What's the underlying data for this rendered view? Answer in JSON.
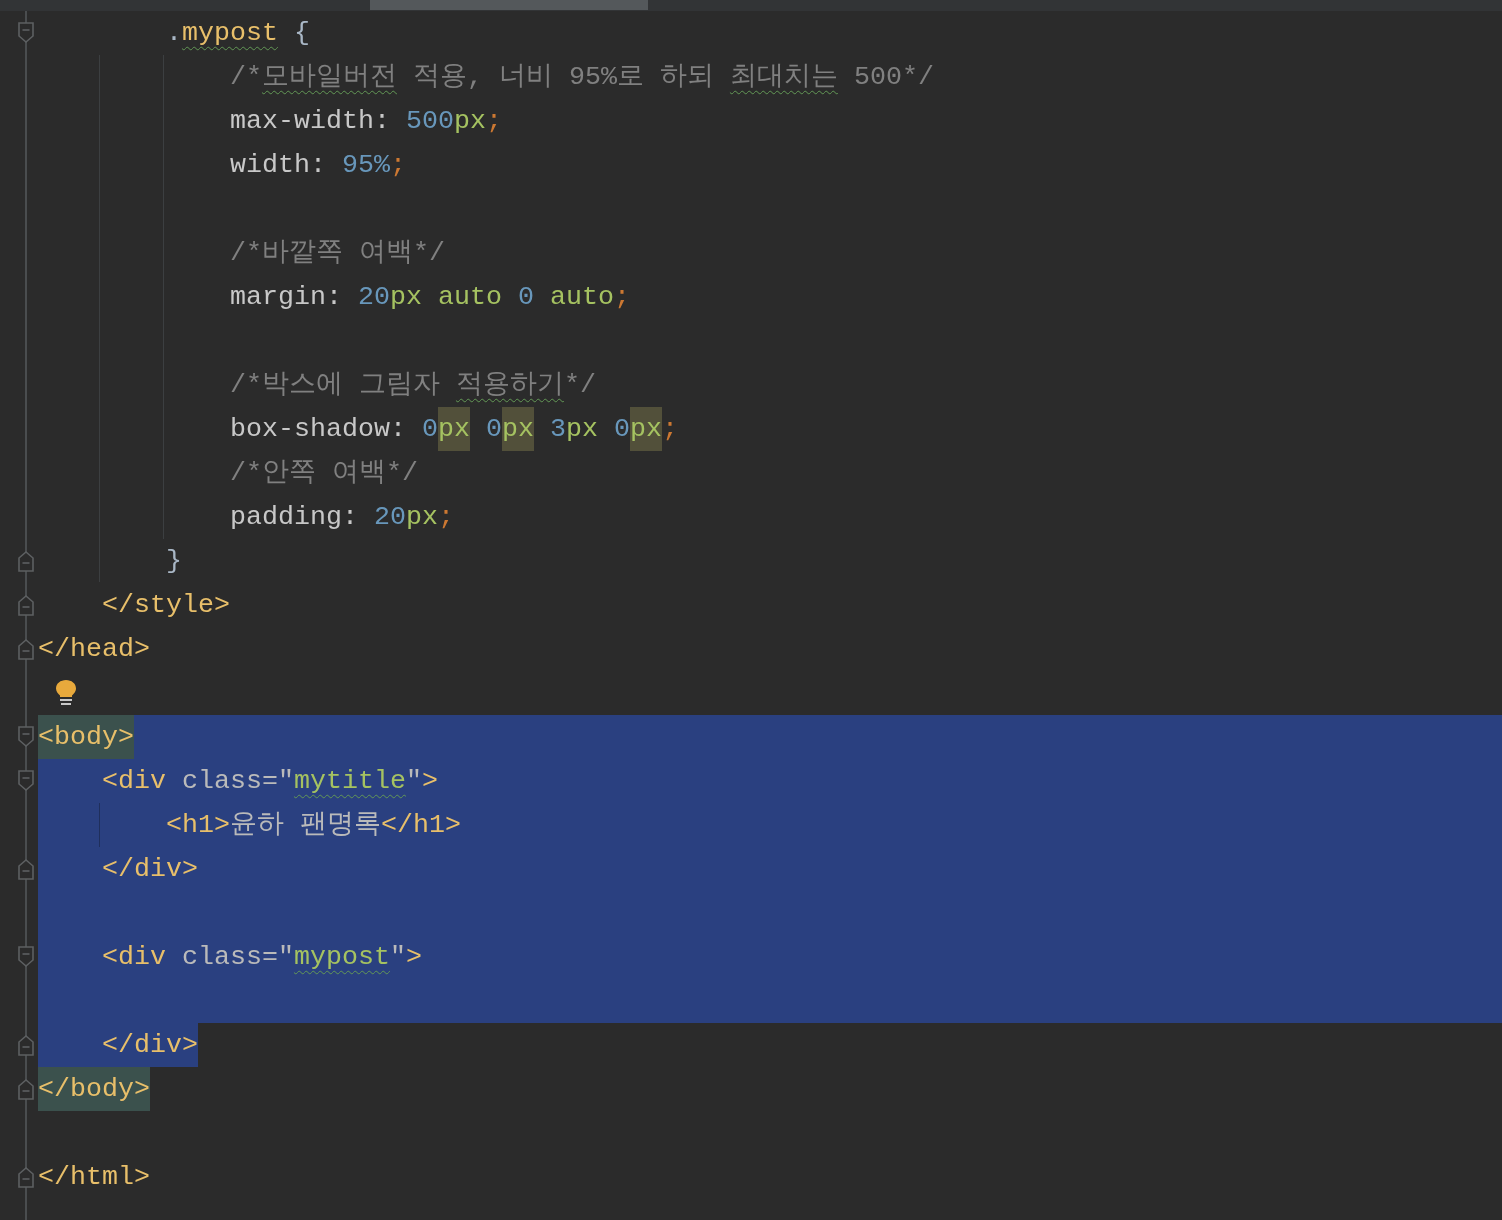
{
  "editor": {
    "lines": [
      {
        "kind": "fold-start",
        "selected": false,
        "tokens": [
          {
            "kind": "plain",
            "text": "        ."
          },
          {
            "kind": "selector",
            "text": "mypost",
            "squiggle": true
          },
          {
            "kind": "plain",
            "text": " {"
          }
        ]
      },
      {
        "kind": "plain",
        "selected": false,
        "tokens": [
          {
            "kind": "comment",
            "text": "            /*"
          },
          {
            "kind": "comment",
            "text": "모바일버전",
            "squiggle": true
          },
          {
            "kind": "comment",
            "text": " 적용, 너비 95%로 하되 "
          },
          {
            "kind": "comment",
            "text": "최대치는",
            "squiggle": true
          },
          {
            "kind": "comment",
            "text": " 500*/"
          }
        ]
      },
      {
        "kind": "plain",
        "selected": false,
        "tokens": [
          {
            "kind": "prop",
            "text": "            max-width: "
          },
          {
            "kind": "number",
            "text": "500"
          },
          {
            "kind": "unit",
            "text": "px"
          },
          {
            "kind": "semi",
            "text": ";"
          }
        ]
      },
      {
        "kind": "plain",
        "selected": false,
        "tokens": [
          {
            "kind": "prop",
            "text": "            width: "
          },
          {
            "kind": "number",
            "text": "95%"
          },
          {
            "kind": "semi",
            "text": ";"
          }
        ]
      },
      {
        "kind": "plain",
        "selected": false
      },
      {
        "kind": "plain",
        "selected": false,
        "tokens": [
          {
            "kind": "comment",
            "text": "            /*바깥쪽 여백*/"
          }
        ]
      },
      {
        "kind": "plain",
        "selected": false,
        "tokens": [
          {
            "kind": "prop",
            "text": "            margin: "
          },
          {
            "kind": "number",
            "text": "20"
          },
          {
            "kind": "unit",
            "text": "px auto"
          },
          {
            "kind": "number",
            "text": " 0"
          },
          {
            "kind": "unit",
            "text": " auto"
          },
          {
            "kind": "semi",
            "text": ";"
          }
        ]
      },
      {
        "kind": "plain",
        "selected": false
      },
      {
        "kind": "plain",
        "selected": false,
        "tokens": [
          {
            "kind": "comment",
            "text": "            /*박스에 그림자 "
          },
          {
            "kind": "comment",
            "text": "적용하기",
            "squiggle": true
          },
          {
            "kind": "comment",
            "text": "*/"
          }
        ]
      },
      {
        "kind": "plain",
        "selected": false,
        "tokens": [
          {
            "kind": "prop",
            "text": "            box-shadow: "
          },
          {
            "kind": "number",
            "text": "0"
          },
          {
            "kind": "unit",
            "text": "px",
            "occurrence": true
          },
          {
            "kind": "number",
            "text": " 0"
          },
          {
            "kind": "unit",
            "text": "px",
            "occurrence": true
          },
          {
            "kind": "number",
            "text": " 3"
          },
          {
            "kind": "unit",
            "text": "px"
          },
          {
            "kind": "number",
            "text": " 0"
          },
          {
            "kind": "unit",
            "text": "px",
            "occurrence": true
          },
          {
            "kind": "semi",
            "text": ";"
          }
        ]
      },
      {
        "kind": "plain",
        "selected": false,
        "tokens": [
          {
            "kind": "comment",
            "text": "            /*안쪽 여백*/"
          }
        ]
      },
      {
        "kind": "plain",
        "selected": false,
        "tokens": [
          {
            "kind": "prop",
            "text": "            padding: "
          },
          {
            "kind": "number",
            "text": "20"
          },
          {
            "kind": "unit",
            "text": "px"
          },
          {
            "kind": "semi",
            "text": ";"
          }
        ]
      },
      {
        "kind": "fold-end",
        "selected": false,
        "tokens": [
          {
            "kind": "plain",
            "text": "        }"
          }
        ]
      },
      {
        "kind": "fold-end",
        "selected": false,
        "tokens": [
          {
            "kind": "tag",
            "text": "    </style>"
          }
        ]
      },
      {
        "kind": "fold-end",
        "selected": false,
        "tokens": [
          {
            "kind": "tag",
            "text": "</head>"
          }
        ]
      },
      {
        "kind": "plain",
        "selected": false,
        "bulb": true
      },
      {
        "kind": "fold-start",
        "selected": true,
        "tokens": [
          {
            "kind": "tag",
            "text": "<body>",
            "match": true
          }
        ]
      },
      {
        "kind": "fold-start",
        "selected": true,
        "tokens": [
          {
            "kind": "tag",
            "text": "    <div"
          },
          {
            "kind": "attr",
            "text": " class=\""
          },
          {
            "kind": "string",
            "text": "mytitle",
            "squiggle": true
          },
          {
            "kind": "attr",
            "text": "\""
          },
          {
            "kind": "tag",
            "text": ">"
          }
        ]
      },
      {
        "kind": "plain",
        "selected": true,
        "tokens": [
          {
            "kind": "tag",
            "text": "        <h1>"
          },
          {
            "kind": "attr",
            "text": "윤하 팬명록"
          },
          {
            "kind": "tag",
            "text": "</h1>"
          }
        ]
      },
      {
        "kind": "fold-end",
        "selected": true,
        "tokens": [
          {
            "kind": "tag",
            "text": "    </div>"
          }
        ]
      },
      {
        "kind": "plain",
        "selected": true
      },
      {
        "kind": "fold-start",
        "selected": true,
        "tokens": [
          {
            "kind": "tag",
            "text": "    <div"
          },
          {
            "kind": "attr",
            "text": " class=\""
          },
          {
            "kind": "string",
            "text": "mypost",
            "squiggle": true
          },
          {
            "kind": "attr",
            "text": "\""
          },
          {
            "kind": "tag",
            "text": ">"
          }
        ]
      },
      {
        "kind": "plain",
        "selected": true
      },
      {
        "kind": "fold-end",
        "selected": false,
        "tokens": [
          {
            "kind": "tag",
            "text": "    </div>",
            "selected": true
          }
        ]
      },
      {
        "kind": "fold-end",
        "selected": false,
        "tokens": [
          {
            "kind": "tag",
            "text": "</body>",
            "match": true
          }
        ]
      },
      {
        "kind": "plain",
        "selected": false
      },
      {
        "kind": "fold-end",
        "selected": false,
        "tokens": [
          {
            "kind": "tag",
            "text": "</html>"
          }
        ]
      }
    ]
  }
}
